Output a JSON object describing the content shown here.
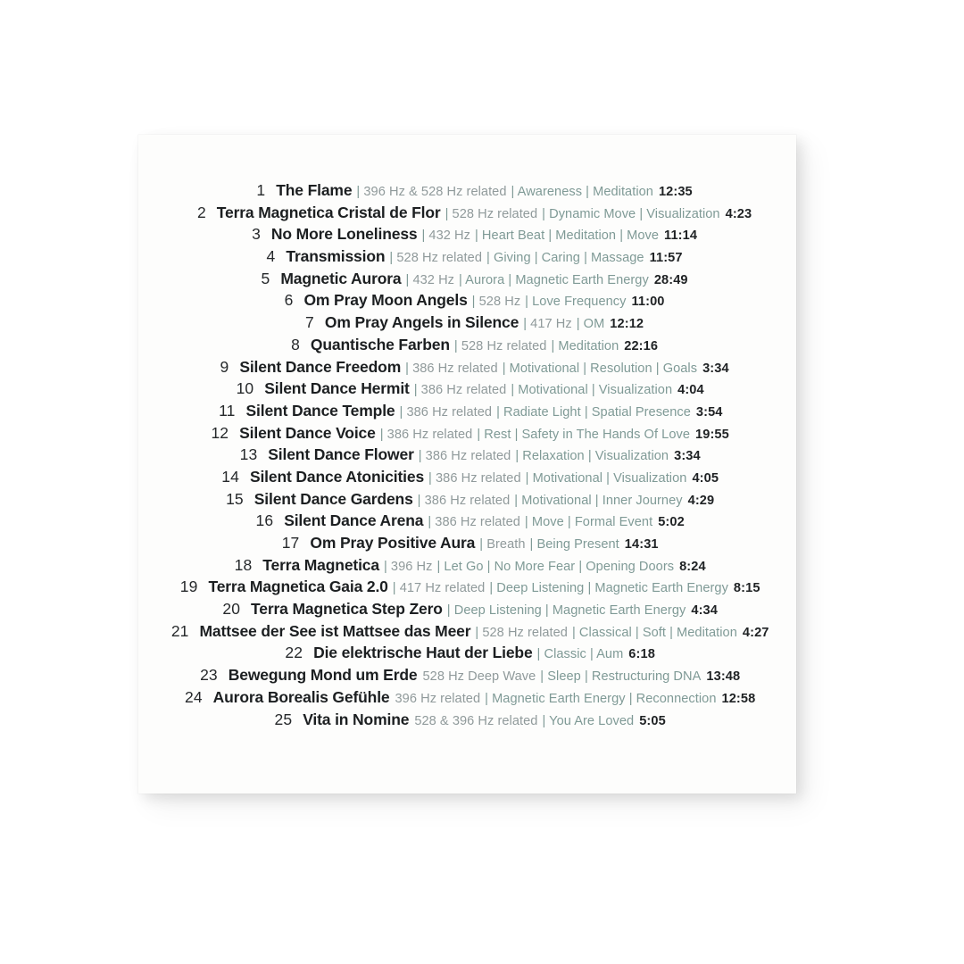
{
  "card": {
    "background_color": "#fdfdfc",
    "page_background_color": "#ffffff"
  },
  "colors": {
    "title": "#1c1f21",
    "number": "#26292b",
    "hz": "#909a9b",
    "tags": "#7f9a96",
    "duration": "#1f2224"
  },
  "tracklist": {
    "tracks": [
      {
        "num": "1",
        "title": "The Flame",
        "hz": "| 396 Hz & 528 Hz related",
        "tags": "| Awareness | Meditation",
        "duration": "12:35"
      },
      {
        "num": "2",
        "title": "Terra Magnetica Cristal de Flor",
        "hz": "| 528 Hz related",
        "tags": "| Dynamic Move | Visualization",
        "duration": "4:23"
      },
      {
        "num": "3",
        "title": "No More Loneliness",
        "hz": "| 432 Hz",
        "tags": "| Heart Beat | Meditation | Move",
        "duration": "11:14"
      },
      {
        "num": "4",
        "title": "Transmission",
        "hz": "| 528 Hz related",
        "tags": "| Giving | Caring | Massage",
        "duration": "11:57"
      },
      {
        "num": "5",
        "title": "Magnetic Aurora",
        "hz": "| 432 Hz",
        "tags": "| Aurora | Magnetic Earth Energy",
        "duration": "28:49"
      },
      {
        "num": "6",
        "title": "Om Pray Moon Angels",
        "hz": "| 528 Hz",
        "tags": "| Love Frequency",
        "duration": "11:00"
      },
      {
        "num": "7",
        "title": "Om Pray Angels in Silence",
        "hz": "| 417 Hz",
        "tags": "| OM",
        "duration": "12:12"
      },
      {
        "num": "8",
        "title": "Quantische Farben",
        "hz": "| 528 Hz related",
        "tags": "| Meditation",
        "duration": "22:16"
      },
      {
        "num": "9",
        "title": "Silent Dance Freedom",
        "hz": "| 386 Hz related",
        "tags": "| Motivational | Resolution | Goals",
        "duration": "3:34"
      },
      {
        "num": "10",
        "title": "Silent Dance Hermit",
        "hz": "| 386 Hz related",
        "tags": "| Motivational | Visualization",
        "duration": "4:04"
      },
      {
        "num": "11",
        "title": "Silent Dance Temple",
        "hz": "| 386 Hz related",
        "tags": "| Radiate Light | Spatial Presence",
        "duration": "3:54"
      },
      {
        "num": "12",
        "title": "Silent Dance Voice",
        "hz": "| 386 Hz related",
        "tags": "| Rest | Safety in The Hands Of Love",
        "duration": "19:55"
      },
      {
        "num": "13",
        "title": "Silent Dance Flower",
        "hz": "| 386 Hz related",
        "tags": "| Relaxation | Visualization",
        "duration": "3:34"
      },
      {
        "num": "14",
        "title": "Silent Dance Atonicities",
        "hz": "| 386 Hz related",
        "tags": "| Motivational | Visualization",
        "duration": "4:05"
      },
      {
        "num": "15",
        "title": "Silent Dance Gardens",
        "hz": "| 386 Hz related",
        "tags": "| Motivational | Inner Journey",
        "duration": "4:29"
      },
      {
        "num": "16",
        "title": "Silent Dance Arena",
        "hz": "| 386 Hz related",
        "tags": "| Move | Formal Event",
        "duration": "5:02"
      },
      {
        "num": "17",
        "title": "Om Pray Positive Aura",
        "hz": "| Breath",
        "tags": "| Being Present",
        "duration": "14:31"
      },
      {
        "num": "18",
        "title": "Terra Magnetica",
        "hz": "| 396 Hz",
        "tags": "| Let Go | No More Fear | Opening Doors",
        "duration": "8:24"
      },
      {
        "num": "19",
        "title": "Terra Magnetica Gaia 2.0",
        "hz": "| 417 Hz related",
        "tags": "| Deep Listening | Magnetic Earth Energy",
        "duration": "8:15"
      },
      {
        "num": "20",
        "title": "Terra Magnetica Step Zero",
        "hz": "",
        "tags": "| Deep Listening | Magnetic Earth Energy",
        "duration": "4:34"
      },
      {
        "num": "21",
        "title": "Mattsee der See ist Mattsee das Meer",
        "hz": "| 528 Hz related",
        "tags": "| Classical | Soft | Meditation",
        "duration": "4:27"
      },
      {
        "num": "22",
        "title": "Die elektrische Haut der Liebe",
        "hz": "",
        "tags": "| Classic | Aum",
        "duration": "6:18"
      },
      {
        "num": "23",
        "title": "Bewegung Mond um Erde",
        "hz": "528 Hz Deep Wave",
        "tags": "| Sleep | Restructuring DNA",
        "duration": "13:48"
      },
      {
        "num": "24",
        "title": "Aurora Borealis Gefühle",
        "hz": "396 Hz related",
        "tags": "| Magnetic Earth Energy | Reconnection",
        "duration": "12:58"
      },
      {
        "num": "25",
        "title": "Vita in Nomine",
        "hz": "528 & 396 Hz related",
        "tags": "| You Are Loved",
        "duration": "5:05"
      }
    ]
  }
}
